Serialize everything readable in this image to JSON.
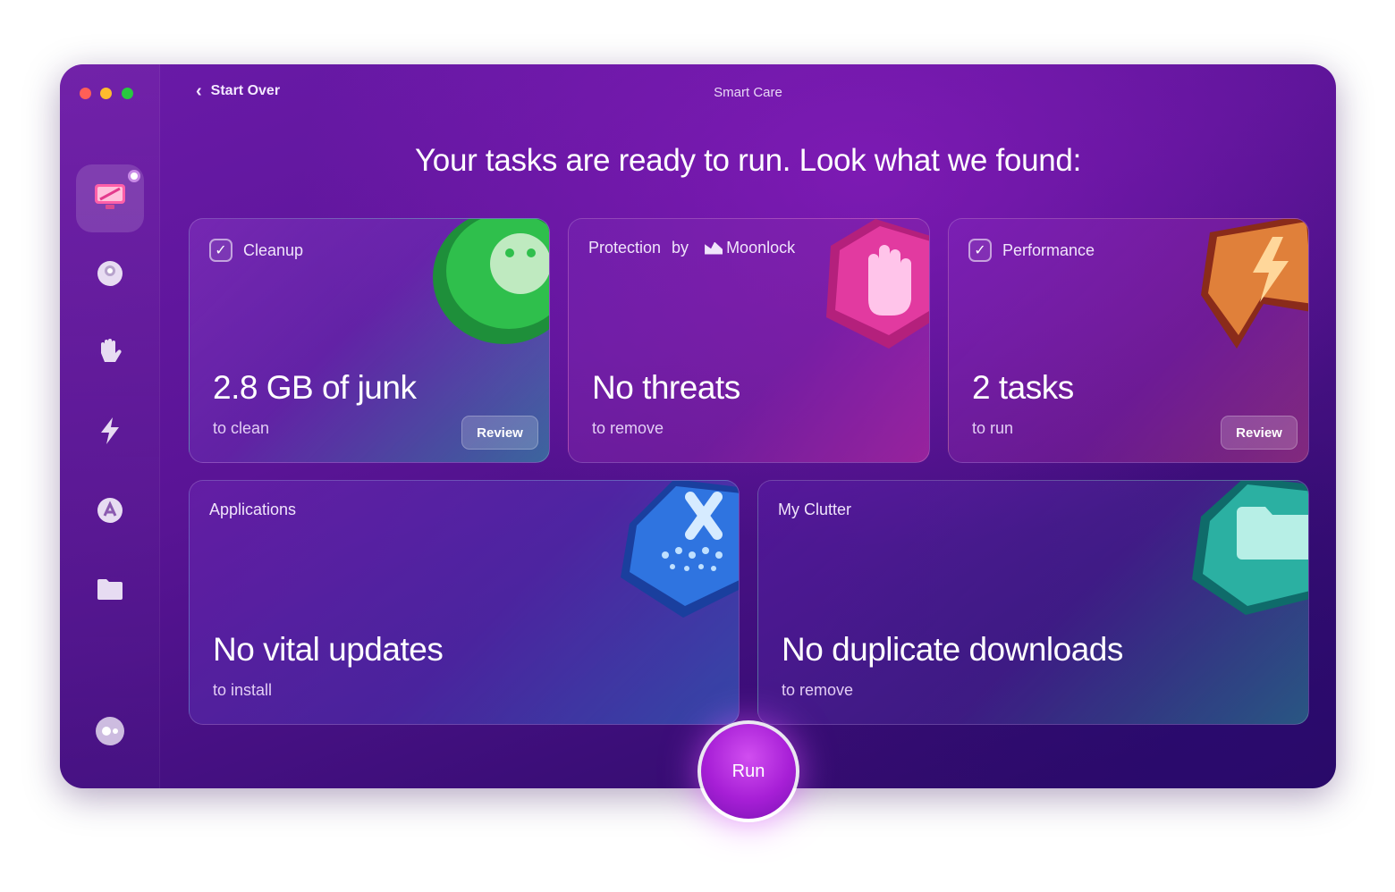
{
  "window": {
    "title": "Smart Care"
  },
  "nav": {
    "back_label": "Start Over"
  },
  "headline": "Your tasks are ready to run. Look what we found:",
  "sidebar": {
    "items": [
      {
        "icon": "smart-care-icon",
        "active": true
      },
      {
        "icon": "cleanup-icon"
      },
      {
        "icon": "protection-icon"
      },
      {
        "icon": "performance-icon"
      },
      {
        "icon": "applications-icon"
      },
      {
        "icon": "my-clutter-icon"
      },
      {
        "icon": "assistant-icon"
      }
    ]
  },
  "cards": {
    "cleanup": {
      "label": "Cleanup",
      "checked": true,
      "value": "2.8 GB of junk",
      "sub": "to clean",
      "button": "Review"
    },
    "protection": {
      "label": "Protection",
      "by": "by",
      "brand": "Moonlock",
      "value": "No threats",
      "sub": "to remove"
    },
    "performance": {
      "label": "Performance",
      "checked": true,
      "value": "2 tasks",
      "sub": "to run",
      "button": "Review"
    },
    "applications": {
      "label": "Applications",
      "value": "No vital updates",
      "sub": "to install"
    },
    "clutter": {
      "label": "My Clutter",
      "value": "No duplicate downloads",
      "sub": "to remove"
    }
  },
  "run_button": "Run",
  "colors": {
    "accent": "#b12ee0",
    "window_bg": "#5a1496"
  }
}
